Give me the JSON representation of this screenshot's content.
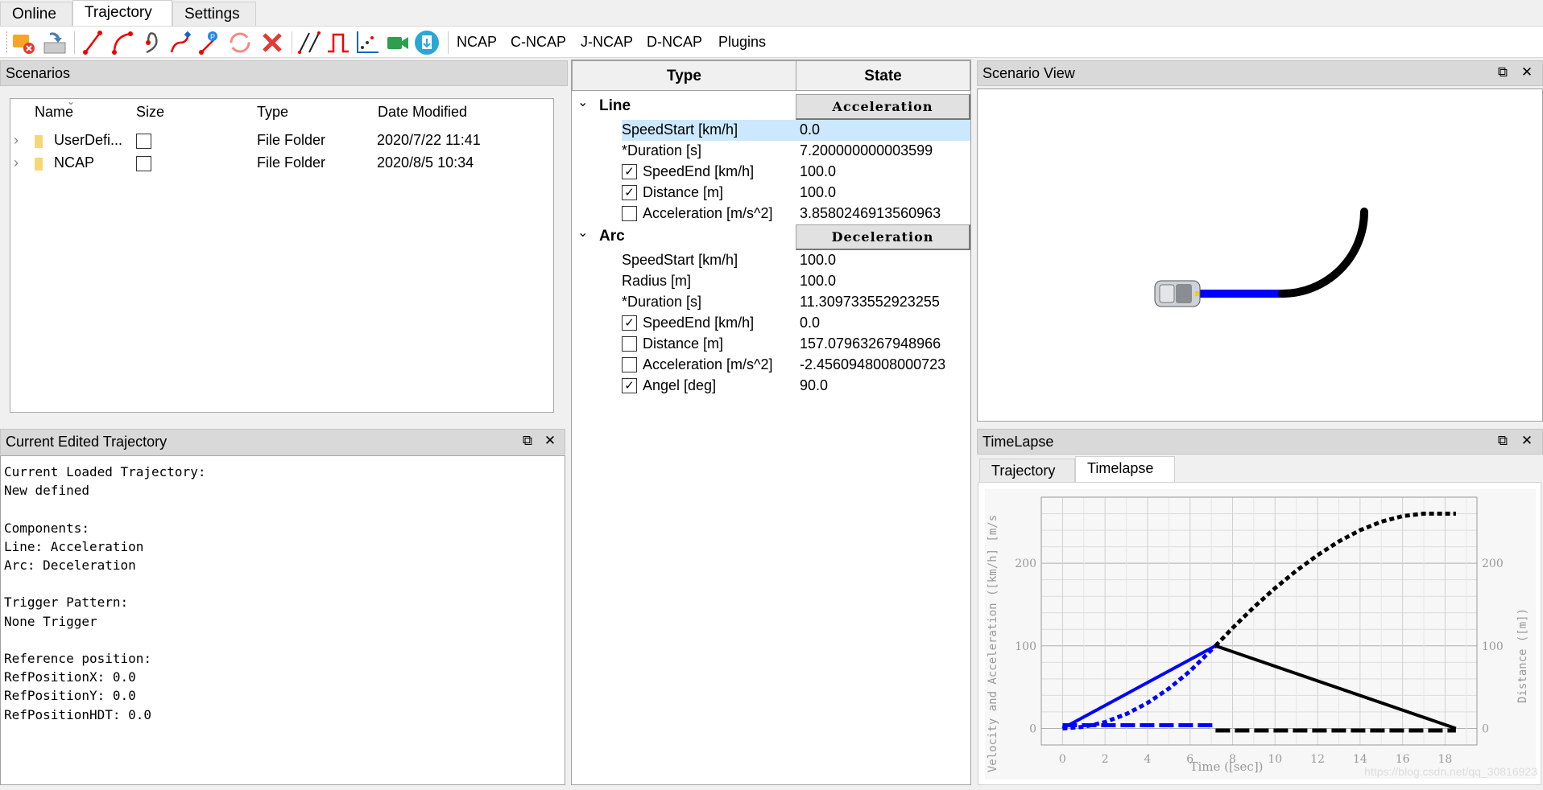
{
  "main_tabs": [
    {
      "label": "Online"
    },
    {
      "label": "Trajectory"
    },
    {
      "label": "Settings"
    }
  ],
  "toolbar": {
    "icons": [
      "delete-scenario-icon",
      "import-icon",
      "line-icon",
      "arc-icon",
      "clothoid-icon",
      "s-curve-icon",
      "waypoint-icon",
      "loop-icon",
      "delete-icon",
      "lane-change-icon",
      "pulse-icon",
      "scatter-plot-icon",
      "camera-icon",
      "export-icon"
    ],
    "text_buttons": [
      "NCAP",
      "C-NCAP",
      "J-NCAP",
      "D-NCAP",
      "Plugins"
    ]
  },
  "scenarios": {
    "title": "Scenarios",
    "columns": [
      "Name",
      "Size",
      "Type",
      "Date Modified"
    ],
    "rows": [
      {
        "name": "UserDefi...",
        "type": "File Folder",
        "date": "2020/7/22 11:41"
      },
      {
        "name": "NCAP",
        "type": "File Folder",
        "date": "2020/8/5 10:34"
      }
    ]
  },
  "current_trajectory": {
    "title": "Current Edited Trajectory",
    "text": "Current Loaded Trajectory:\nNew defined\n\nComponents:\nLine: Acceleration\nArc: Deceleration\n\nTrigger Pattern:\nNone Trigger\n\nReference position:\nRefPositionX: 0.0\nRefPositionY: 0.0\nRefPositionHDT: 0.0"
  },
  "properties": {
    "headers": {
      "type": "Type",
      "state": "State"
    },
    "groups": [
      {
        "name": "Line",
        "state": "Acceleration",
        "rows": [
          {
            "label": "SpeedStart [km/h]",
            "value": "0.0",
            "checkbox": null,
            "selected": true
          },
          {
            "label": "*Duration [s]",
            "value": "7.200000000003599",
            "checkbox": null
          },
          {
            "label": "SpeedEnd [km/h]",
            "value": "100.0",
            "checkbox": true
          },
          {
            "label": "Distance [m]",
            "value": "100.0",
            "checkbox": true
          },
          {
            "label": "Acceleration [m/s^2]",
            "value": "3.8580246913560963",
            "checkbox": false
          }
        ]
      },
      {
        "name": "Arc",
        "state": "Deceleration",
        "rows": [
          {
            "label": "SpeedStart [km/h]",
            "value": "100.0",
            "checkbox": null
          },
          {
            "label": "Radius [m]",
            "value": "100.0",
            "checkbox": null
          },
          {
            "label": "*Duration [s]",
            "value": "11.309733552923255",
            "checkbox": null
          },
          {
            "label": "SpeedEnd [km/h]",
            "value": "0.0",
            "checkbox": true
          },
          {
            "label": "Distance [m]",
            "value": "157.07963267948966",
            "checkbox": false
          },
          {
            "label": "Acceleration [m/s^2]",
            "value": "-2.4560948008000723",
            "checkbox": false
          },
          {
            "label": "Angel [deg]",
            "value": "90.0",
            "checkbox": true
          }
        ]
      }
    ]
  },
  "scenario_view": {
    "title": "Scenario View",
    "line_color": "#0000ff",
    "arc_color": "#000000"
  },
  "timelapse": {
    "title": "TimeLapse",
    "tabs": [
      "Trajectory",
      "Timelapse"
    ],
    "active_tab": "Timelapse",
    "watermark": "https://blog.csdn.net/qq_30816923"
  },
  "chart_data": {
    "type": "line",
    "xlabel": "Time ([sec])",
    "ylabel": "Velocity and Acceleration ([km/h] [m/s",
    "y2label": "Distance ([m])",
    "xlim": [
      -1,
      19.5
    ],
    "ylim": [
      -20,
      280
    ],
    "xticks": [
      0,
      2,
      4,
      6,
      8,
      10,
      12,
      14,
      16,
      18
    ],
    "yticks": [
      0,
      100,
      200
    ],
    "y2ticks": [
      0,
      100,
      200
    ],
    "grid": true,
    "series": [
      {
        "style": "solid",
        "color": "#0000ff",
        "x": [
          0,
          7.2
        ],
        "y": [
          0,
          100
        ]
      },
      {
        "style": "dotted",
        "color": "#0000ff",
        "x": [
          0,
          1,
          2,
          3,
          4,
          5,
          6,
          7.2
        ],
        "y": [
          0,
          1.9,
          7.7,
          17.4,
          30.9,
          48.2,
          69.4,
          100
        ]
      },
      {
        "style": "dashed",
        "color": "#0000ff",
        "x": [
          0,
          7.2
        ],
        "y": [
          3.86,
          3.86
        ]
      },
      {
        "style": "solid",
        "color": "#000000",
        "x": [
          7.2,
          18.51
        ],
        "y": [
          100,
          0
        ]
      },
      {
        "style": "dotted",
        "color": "#000000",
        "x": [
          7.2,
          8,
          9,
          10,
          11,
          12,
          13,
          14,
          15,
          16,
          17,
          18,
          18.51
        ],
        "y": [
          100,
          121.6,
          146.7,
          169.9,
          190.9,
          209.8,
          226.4,
          240,
          250.3,
          257.1,
          260,
          260,
          260
        ]
      },
      {
        "style": "dashed",
        "color": "#000000",
        "x": [
          7.2,
          18.51
        ],
        "y": [
          -2.46,
          -2.46
        ]
      }
    ]
  }
}
